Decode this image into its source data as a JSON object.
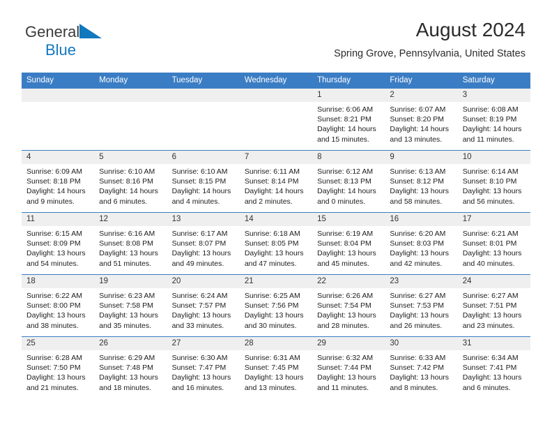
{
  "logo": {
    "word1": "General",
    "word2": "Blue",
    "triangle_color": "#1278be",
    "word1_color": "#3a3a3a",
    "word2_color": "#1278be"
  },
  "header": {
    "title": "August 2024",
    "subtitle": "Spring Grove, Pennsylvania, United States",
    "accent_color": "#3b7dc4",
    "daynum_band_color": "#efefef"
  },
  "weekdays": [
    "Sunday",
    "Monday",
    "Tuesday",
    "Wednesday",
    "Thursday",
    "Friday",
    "Saturday"
  ],
  "weeks": [
    [
      {
        "blank": true
      },
      {
        "blank": true
      },
      {
        "blank": true
      },
      {
        "blank": true
      },
      {
        "day": "1",
        "sunrise": "Sunrise: 6:06 AM",
        "sunset": "Sunset: 8:21 PM",
        "daylight1": "Daylight: 14 hours",
        "daylight2": "and 15 minutes."
      },
      {
        "day": "2",
        "sunrise": "Sunrise: 6:07 AM",
        "sunset": "Sunset: 8:20 PM",
        "daylight1": "Daylight: 14 hours",
        "daylight2": "and 13 minutes."
      },
      {
        "day": "3",
        "sunrise": "Sunrise: 6:08 AM",
        "sunset": "Sunset: 8:19 PM",
        "daylight1": "Daylight: 14 hours",
        "daylight2": "and 11 minutes."
      }
    ],
    [
      {
        "day": "4",
        "sunrise": "Sunrise: 6:09 AM",
        "sunset": "Sunset: 8:18 PM",
        "daylight1": "Daylight: 14 hours",
        "daylight2": "and 9 minutes."
      },
      {
        "day": "5",
        "sunrise": "Sunrise: 6:10 AM",
        "sunset": "Sunset: 8:16 PM",
        "daylight1": "Daylight: 14 hours",
        "daylight2": "and 6 minutes."
      },
      {
        "day": "6",
        "sunrise": "Sunrise: 6:10 AM",
        "sunset": "Sunset: 8:15 PM",
        "daylight1": "Daylight: 14 hours",
        "daylight2": "and 4 minutes."
      },
      {
        "day": "7",
        "sunrise": "Sunrise: 6:11 AM",
        "sunset": "Sunset: 8:14 PM",
        "daylight1": "Daylight: 14 hours",
        "daylight2": "and 2 minutes."
      },
      {
        "day": "8",
        "sunrise": "Sunrise: 6:12 AM",
        "sunset": "Sunset: 8:13 PM",
        "daylight1": "Daylight: 14 hours",
        "daylight2": "and 0 minutes."
      },
      {
        "day": "9",
        "sunrise": "Sunrise: 6:13 AM",
        "sunset": "Sunset: 8:12 PM",
        "daylight1": "Daylight: 13 hours",
        "daylight2": "and 58 minutes."
      },
      {
        "day": "10",
        "sunrise": "Sunrise: 6:14 AM",
        "sunset": "Sunset: 8:10 PM",
        "daylight1": "Daylight: 13 hours",
        "daylight2": "and 56 minutes."
      }
    ],
    [
      {
        "day": "11",
        "sunrise": "Sunrise: 6:15 AM",
        "sunset": "Sunset: 8:09 PM",
        "daylight1": "Daylight: 13 hours",
        "daylight2": "and 54 minutes."
      },
      {
        "day": "12",
        "sunrise": "Sunrise: 6:16 AM",
        "sunset": "Sunset: 8:08 PM",
        "daylight1": "Daylight: 13 hours",
        "daylight2": "and 51 minutes."
      },
      {
        "day": "13",
        "sunrise": "Sunrise: 6:17 AM",
        "sunset": "Sunset: 8:07 PM",
        "daylight1": "Daylight: 13 hours",
        "daylight2": "and 49 minutes."
      },
      {
        "day": "14",
        "sunrise": "Sunrise: 6:18 AM",
        "sunset": "Sunset: 8:05 PM",
        "daylight1": "Daylight: 13 hours",
        "daylight2": "and 47 minutes."
      },
      {
        "day": "15",
        "sunrise": "Sunrise: 6:19 AM",
        "sunset": "Sunset: 8:04 PM",
        "daylight1": "Daylight: 13 hours",
        "daylight2": "and 45 minutes."
      },
      {
        "day": "16",
        "sunrise": "Sunrise: 6:20 AM",
        "sunset": "Sunset: 8:03 PM",
        "daylight1": "Daylight: 13 hours",
        "daylight2": "and 42 minutes."
      },
      {
        "day": "17",
        "sunrise": "Sunrise: 6:21 AM",
        "sunset": "Sunset: 8:01 PM",
        "daylight1": "Daylight: 13 hours",
        "daylight2": "and 40 minutes."
      }
    ],
    [
      {
        "day": "18",
        "sunrise": "Sunrise: 6:22 AM",
        "sunset": "Sunset: 8:00 PM",
        "daylight1": "Daylight: 13 hours",
        "daylight2": "and 38 minutes."
      },
      {
        "day": "19",
        "sunrise": "Sunrise: 6:23 AM",
        "sunset": "Sunset: 7:58 PM",
        "daylight1": "Daylight: 13 hours",
        "daylight2": "and 35 minutes."
      },
      {
        "day": "20",
        "sunrise": "Sunrise: 6:24 AM",
        "sunset": "Sunset: 7:57 PM",
        "daylight1": "Daylight: 13 hours",
        "daylight2": "and 33 minutes."
      },
      {
        "day": "21",
        "sunrise": "Sunrise: 6:25 AM",
        "sunset": "Sunset: 7:56 PM",
        "daylight1": "Daylight: 13 hours",
        "daylight2": "and 30 minutes."
      },
      {
        "day": "22",
        "sunrise": "Sunrise: 6:26 AM",
        "sunset": "Sunset: 7:54 PM",
        "daylight1": "Daylight: 13 hours",
        "daylight2": "and 28 minutes."
      },
      {
        "day": "23",
        "sunrise": "Sunrise: 6:27 AM",
        "sunset": "Sunset: 7:53 PM",
        "daylight1": "Daylight: 13 hours",
        "daylight2": "and 26 minutes."
      },
      {
        "day": "24",
        "sunrise": "Sunrise: 6:27 AM",
        "sunset": "Sunset: 7:51 PM",
        "daylight1": "Daylight: 13 hours",
        "daylight2": "and 23 minutes."
      }
    ],
    [
      {
        "day": "25",
        "sunrise": "Sunrise: 6:28 AM",
        "sunset": "Sunset: 7:50 PM",
        "daylight1": "Daylight: 13 hours",
        "daylight2": "and 21 minutes."
      },
      {
        "day": "26",
        "sunrise": "Sunrise: 6:29 AM",
        "sunset": "Sunset: 7:48 PM",
        "daylight1": "Daylight: 13 hours",
        "daylight2": "and 18 minutes."
      },
      {
        "day": "27",
        "sunrise": "Sunrise: 6:30 AM",
        "sunset": "Sunset: 7:47 PM",
        "daylight1": "Daylight: 13 hours",
        "daylight2": "and 16 minutes."
      },
      {
        "day": "28",
        "sunrise": "Sunrise: 6:31 AM",
        "sunset": "Sunset: 7:45 PM",
        "daylight1": "Daylight: 13 hours",
        "daylight2": "and 13 minutes."
      },
      {
        "day": "29",
        "sunrise": "Sunrise: 6:32 AM",
        "sunset": "Sunset: 7:44 PM",
        "daylight1": "Daylight: 13 hours",
        "daylight2": "and 11 minutes."
      },
      {
        "day": "30",
        "sunrise": "Sunrise: 6:33 AM",
        "sunset": "Sunset: 7:42 PM",
        "daylight1": "Daylight: 13 hours",
        "daylight2": "and 8 minutes."
      },
      {
        "day": "31",
        "sunrise": "Sunrise: 6:34 AM",
        "sunset": "Sunset: 7:41 PM",
        "daylight1": "Daylight: 13 hours",
        "daylight2": "and 6 minutes."
      }
    ]
  ]
}
